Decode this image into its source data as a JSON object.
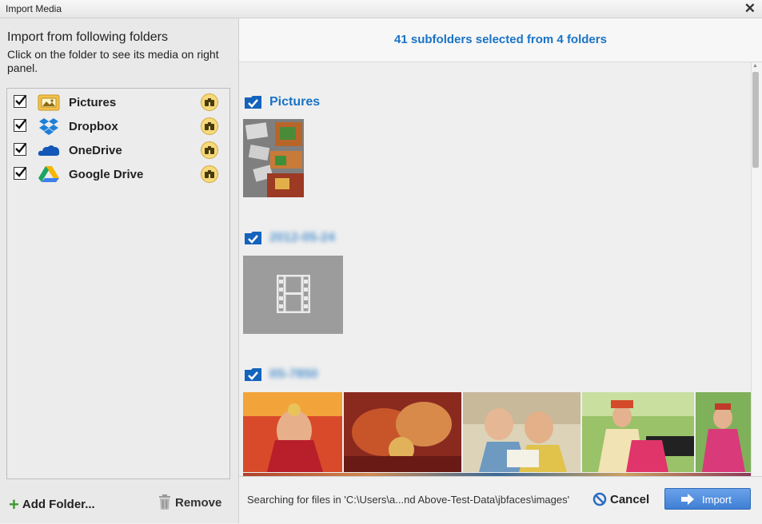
{
  "window": {
    "title": "Import Media"
  },
  "left": {
    "heading": "Import from following folders",
    "subheading": "Click on the folder to see its media on right panel.",
    "folders": [
      {
        "name": "Pictures",
        "checked": true,
        "icon": "pictures-folder-icon"
      },
      {
        "name": "Dropbox",
        "checked": true,
        "icon": "dropbox-icon"
      },
      {
        "name": "OneDrive",
        "checked": true,
        "icon": "onedrive-icon"
      },
      {
        "name": "Google Drive",
        "checked": true,
        "icon": "google-drive-icon"
      }
    ],
    "add_folder_label": "Add Folder...",
    "remove_label": "Remove"
  },
  "right": {
    "summary": "41 subfolders selected from 4 folders",
    "groups": [
      {
        "label": "Pictures",
        "blurred": false
      },
      {
        "label": "2012-05-24",
        "blurred": true
      },
      {
        "label": "IIS-7850",
        "blurred": true
      }
    ],
    "status": "Searching for files in 'C:\\Users\\a...nd Above-Test-Data\\jbfaces\\images'",
    "cancel_label": "Cancel",
    "import_label": "Import"
  },
  "colors": {
    "accent": "#1a73c4",
    "import_button": "#4a8ce0",
    "add_plus": "#3b9b2f"
  }
}
